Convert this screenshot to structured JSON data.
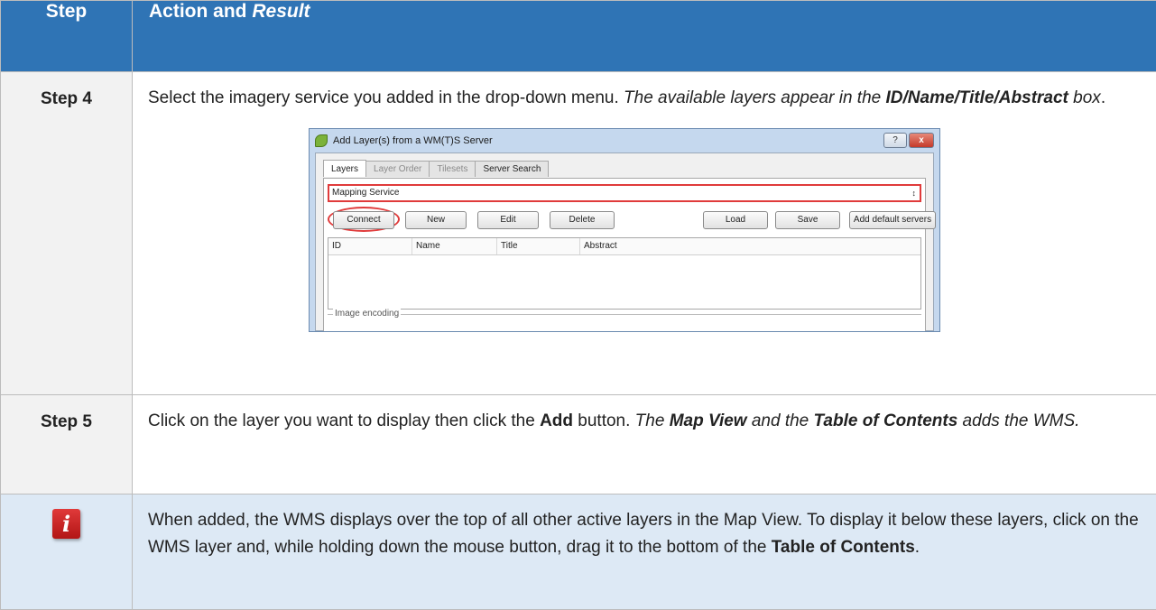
{
  "header": {
    "col1": "Step",
    "col2_a": "Action and ",
    "col2_b": "Result"
  },
  "step4": {
    "label": "Step 4",
    "t1": "Select the imagery service you added in the drop-down menu. ",
    "t2": "The available layers appear in the ",
    "t3": "ID/Name/Title/Abstract",
    "t4": " box",
    "t5": "."
  },
  "dialog": {
    "title": "Add Layer(s) from a WM(T)S Server",
    "help": "?",
    "close": "x",
    "tabs": [
      "Layers",
      "Layer Order",
      "Tilesets",
      "Server Search"
    ],
    "connection": "Mapping Service",
    "combo_arrow": "↕",
    "buttons": {
      "connect": "Connect",
      "new": "New",
      "edit": "Edit",
      "delete": "Delete",
      "load": "Load",
      "save": "Save",
      "add_default": "Add default servers"
    },
    "columns": [
      "ID",
      "Name",
      "Title",
      "Abstract"
    ],
    "group": "Image encoding"
  },
  "step5": {
    "label": "Step 5",
    "t1": "Click on the layer you want to display then click the ",
    "t2": "Add",
    "t3": " button. ",
    "t4": "The ",
    "t5": "Map View",
    "t6": " and the ",
    "t7": "Table of Contents",
    "t8": " adds the WMS."
  },
  "note": {
    "icon": "i",
    "t1": "When added, the WMS displays over the top of all other active layers in the Map View. To display it below these layers, click on the WMS layer and, while holding down the mouse button, drag it to the bottom of the ",
    "t2": "Table of Contents",
    "t3": "."
  }
}
